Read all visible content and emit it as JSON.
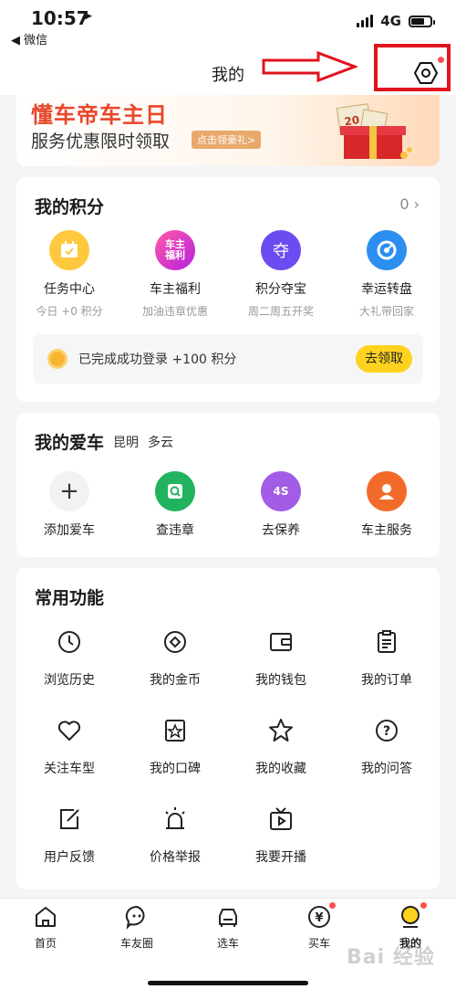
{
  "status_bar": {
    "time": "10:57",
    "back_label": "◀ 微信",
    "network": "4G"
  },
  "header": {
    "title": "我的"
  },
  "banner": {
    "title": "懂车帝车主日",
    "subtitle": "服务优惠限时领取",
    "button": "点击领豪礼>"
  },
  "points": {
    "title": "我的积分",
    "value": "0",
    "items": [
      {
        "label": "任务中心",
        "desc": "今日 +0 积分",
        "icon": "calendar-icon",
        "color": "#ffc83d"
      },
      {
        "label": "车主福利",
        "desc": "加油违章优惠",
        "icon": "welfare-badge-icon",
        "color": "#e63c8c",
        "badge": "车主福利"
      },
      {
        "label": "积分夺宝",
        "desc": "周二周五开奖",
        "icon": "treasure-icon",
        "color": "#6c4cf0",
        "badge": "夺"
      },
      {
        "label": "幸运转盘",
        "desc": "大礼带回家",
        "icon": "wheel-icon",
        "color": "#2b8ef0"
      }
    ],
    "login_text": "已完成成功登录 +100 积分",
    "claim_button": "去领取"
  },
  "car": {
    "title": "我的爱车",
    "location": "昆明",
    "weather": "多云",
    "items": [
      {
        "label": "添加爱车",
        "icon": "plus-icon",
        "color": "#f2f2f2"
      },
      {
        "label": "查违章",
        "icon": "violation-icon",
        "color": "#22b35e"
      },
      {
        "label": "去保养",
        "icon": "maintenance-icon",
        "color": "#a25ce6",
        "badge": "4S"
      },
      {
        "label": "车主服务",
        "icon": "service-icon",
        "color": "#f26b2a"
      }
    ]
  },
  "functions": {
    "title": "常用功能",
    "items": [
      {
        "label": "浏览历史",
        "icon": "clock-icon"
      },
      {
        "label": "我的金币",
        "icon": "coin-icon"
      },
      {
        "label": "我的钱包",
        "icon": "wallet-icon"
      },
      {
        "label": "我的订单",
        "icon": "order-icon"
      },
      {
        "label": "关注车型",
        "icon": "heart-icon"
      },
      {
        "label": "我的口碑",
        "icon": "review-icon"
      },
      {
        "label": "我的收藏",
        "icon": "star-icon"
      },
      {
        "label": "我的问答",
        "icon": "question-icon"
      },
      {
        "label": "用户反馈",
        "icon": "feedback-icon"
      },
      {
        "label": "价格举报",
        "icon": "alarm-icon"
      },
      {
        "label": "我要开播",
        "icon": "tv-icon"
      }
    ]
  },
  "tabs": [
    {
      "label": "首页",
      "icon": "home-icon"
    },
    {
      "label": "车友圈",
      "icon": "chat-icon"
    },
    {
      "label": "选车",
      "icon": "car-icon"
    },
    {
      "label": "买车",
      "icon": "yuan-icon"
    },
    {
      "label": "我的",
      "icon": "profile-icon"
    }
  ],
  "watermark": "Bai 经验",
  "colors": {
    "accent": "#ffd21f",
    "annotation": "#e0131e",
    "badge_red": "#ff4d4f",
    "banner_red": "#e8462a"
  }
}
